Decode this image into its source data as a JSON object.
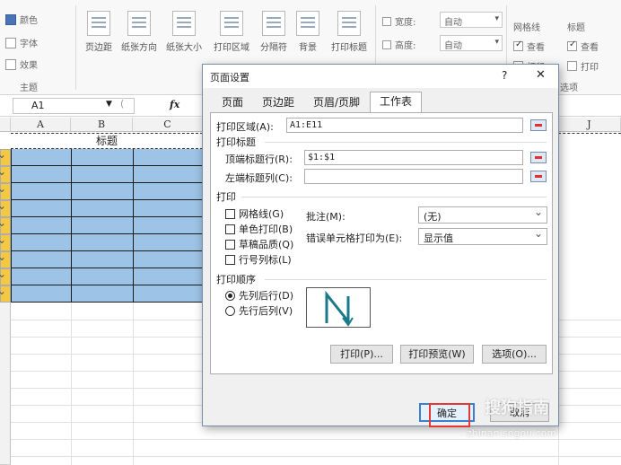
{
  "ribbon": {
    "color_label": "颜色",
    "font_label": "字体",
    "effect_label": "效果",
    "theme_group": "主题",
    "margins": "页边距",
    "orientation": "纸张方向",
    "size": "纸张大小",
    "print_area": "打印区域",
    "breaks": "分隔符",
    "background": "背景",
    "print_titles": "打印标题",
    "width_label": "宽度:",
    "height_label": "高度:",
    "width_value": "自动",
    "height_value": "自动",
    "gridlines_group": "网格线",
    "headings_group": "标题",
    "view_label": "查看",
    "print_label": "打印",
    "options_suffix": "选项"
  },
  "formula_bar": {
    "name_box": "A1",
    "fx": "fx"
  },
  "sheet": {
    "columns": [
      "A",
      "B",
      "C",
      "J"
    ],
    "title_cell": "标题"
  },
  "dialog": {
    "title": "页面设置",
    "help": "?",
    "close": "✕",
    "tabs": [
      "页面",
      "页边距",
      "页眉/页脚",
      "工作表"
    ],
    "print_area_label": "打印区域(A):",
    "print_area_value": "A1:E11",
    "print_titles_section": "打印标题",
    "rows_repeat_label": "顶端标题行(R):",
    "rows_repeat_value": "$1:$1",
    "cols_repeat_label": "左端标题列(C):",
    "cols_repeat_value": "",
    "print_section": "打印",
    "gridlines": "网格线(G)",
    "black_white": "单色打印(B)",
    "draft": "草稿品质(Q)",
    "row_col_headings": "行号列标(L)",
    "comments_label": "批注(M):",
    "comments_value": "(无)",
    "errors_label": "错误单元格打印为(E):",
    "errors_value": "显示值",
    "page_order_section": "打印顺序",
    "down_then_over": "先列后行(D)",
    "over_then_down": "先行后列(V)",
    "print_btn": "打印(P)...",
    "preview_btn": "打印预览(W)",
    "options_btn": "选项(O)...",
    "ok_btn": "确定",
    "cancel_btn": "取消"
  },
  "watermark": {
    "line1": "搜狗指南",
    "line2": "zhinan.sogou.com"
  }
}
